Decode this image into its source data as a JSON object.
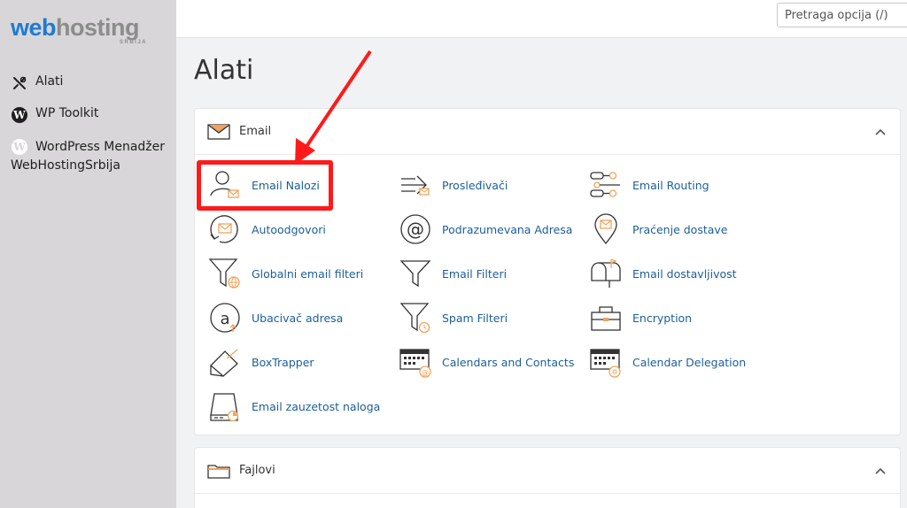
{
  "logo": {
    "part1": "web",
    "part2": "hosting",
    "sub": "SRBIJA"
  },
  "sidebar": {
    "items": [
      {
        "label": "Alati",
        "icon": "tools-icon"
      },
      {
        "label": "WP Toolkit",
        "icon": "wordpress-icon"
      },
      {
        "label": "WordPress Menadžer WebHostingSrbija",
        "icon": "wordpress-icon"
      }
    ]
  },
  "search": {
    "placeholder": "Pretraga opcija (/)"
  },
  "page": {
    "title": "Alati"
  },
  "sections": {
    "email": {
      "title": "Email",
      "icon": "envelope-icon",
      "tools": [
        {
          "label": "Email Nalozi",
          "icon": "email-accounts-icon"
        },
        {
          "label": "Prosleđivači",
          "icon": "forwarders-icon"
        },
        {
          "label": "Email Routing",
          "icon": "email-routing-icon"
        },
        {
          "label": "Autoodgovori",
          "icon": "autoresponders-icon"
        },
        {
          "label": "Podrazumevana Adresa",
          "icon": "default-address-icon"
        },
        {
          "label": "Praćenje dostave",
          "icon": "track-delivery-icon"
        },
        {
          "label": "Globalni email filteri",
          "icon": "global-filters-icon"
        },
        {
          "label": "Email Filteri",
          "icon": "email-filters-icon"
        },
        {
          "label": "Email dostavljivost",
          "icon": "email-deliverability-icon"
        },
        {
          "label": "Ubacivač adresa",
          "icon": "address-importer-icon"
        },
        {
          "label": "Spam Filteri",
          "icon": "spam-filters-icon"
        },
        {
          "label": "Encryption",
          "icon": "encryption-icon"
        },
        {
          "label": "BoxTrapper",
          "icon": "boxtrapper-icon"
        },
        {
          "label": "Calendars and Contacts",
          "icon": "calendars-contacts-icon"
        },
        {
          "label": "Calendar Delegation",
          "icon": "calendar-delegation-icon"
        },
        {
          "label": "Email zauzetost naloga",
          "icon": "email-disk-usage-icon"
        }
      ]
    },
    "fajlovi": {
      "title": "Fajlovi",
      "icon": "folder-icon"
    }
  },
  "colors": {
    "accent": "#f0a35c",
    "link": "#1b5e9b",
    "highlight": "#ff1a1a",
    "sidebar": "#d8d6d8"
  }
}
